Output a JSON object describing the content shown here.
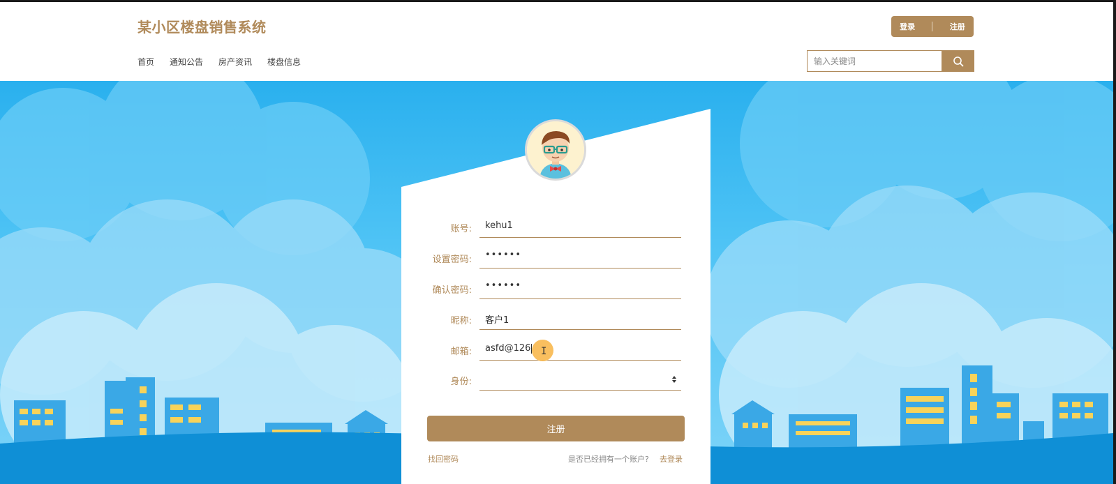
{
  "app": {
    "title": "某小区楼盘销售系统"
  },
  "header": {
    "nav": [
      "首页",
      "通知公告",
      "房产资讯",
      "楼盘信息"
    ],
    "login_label": "登录",
    "register_label": "注册",
    "search": {
      "placeholder": "输入关键词",
      "icon": "search-icon"
    }
  },
  "form": {
    "fields": [
      {
        "label": "账号:",
        "value": "kehu1"
      },
      {
        "label": "设置密码:",
        "value": "••••••"
      },
      {
        "label": "确认密码:",
        "value": "••••••"
      },
      {
        "label": "昵称:",
        "value": "客户1"
      },
      {
        "label": "邮箱:",
        "value": "asfd@126"
      },
      {
        "label": "身份:",
        "value": ""
      }
    ],
    "submit_label": "注册",
    "forgot_label": "找回密码",
    "have_account_text": "是否已经拥有一个账户?",
    "go_login_label": "去登录"
  },
  "colors": {
    "accent": "#b08a5a",
    "sky": "#2ab0ee",
    "building_blue": "#3aa8e6",
    "window_yellow": "#f8d35a"
  }
}
